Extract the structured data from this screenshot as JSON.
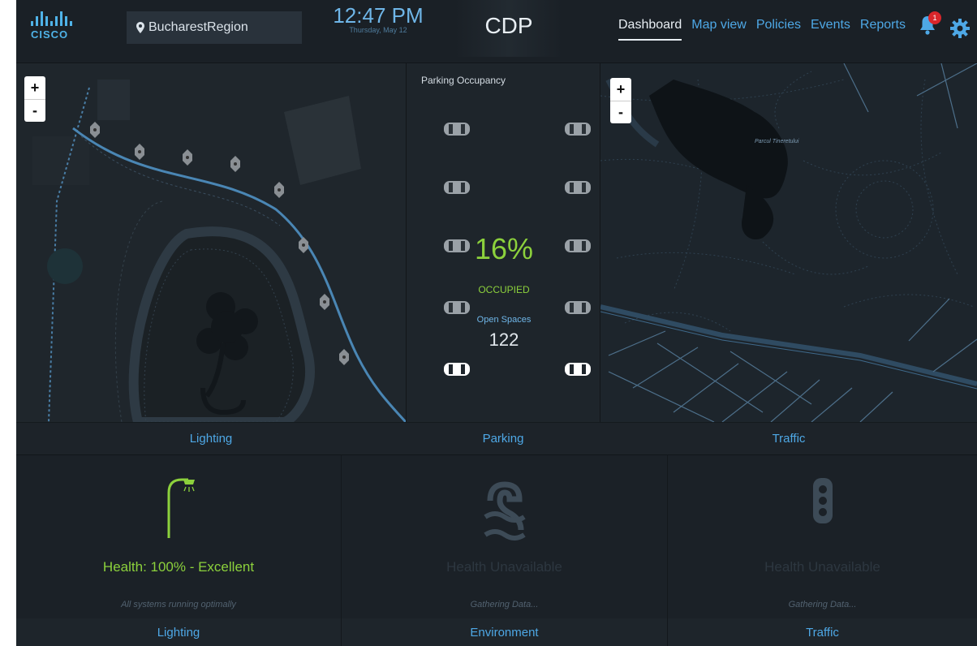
{
  "header": {
    "logo_text": "CISCO",
    "region": "BucharestRegion",
    "time": "12:47 PM",
    "date": "Thursday, May 12",
    "brand": "CDP",
    "nav": [
      "Dashboard",
      "Map view",
      "Policies",
      "Events",
      "Reports"
    ],
    "notification_count": "1"
  },
  "panels": {
    "lighting_map_footer": "Lighting",
    "parking_footer": "Parking",
    "traffic_map_footer": "Traffic",
    "zoom_in": "+",
    "zoom_out": "-"
  },
  "parking": {
    "title": "Parking Occupancy",
    "occupancy_percent": "16%",
    "occupied_label": "OCCUPIED",
    "open_spaces_label": "Open Spaces",
    "open_spaces_value": "122"
  },
  "map_labels": {
    "traffic_park": "Parcul Tineretului"
  },
  "tiles": [
    {
      "health": "Health: 100% - Excellent",
      "sub": "All systems running optimally",
      "footer": "Lighting",
      "health_color": "#8cd13c"
    },
    {
      "health": "Health Unavailable",
      "sub": "Gathering Data...",
      "footer": "Environment",
      "health_color": "#2d3740"
    },
    {
      "health": "Health Unavailable",
      "sub": "Gathering Data...",
      "footer": "Traffic",
      "health_color": "#2d3740"
    }
  ],
  "colors": {
    "accent": "#4ea8e6",
    "good": "#8cd13c",
    "alert": "#d9262b"
  }
}
